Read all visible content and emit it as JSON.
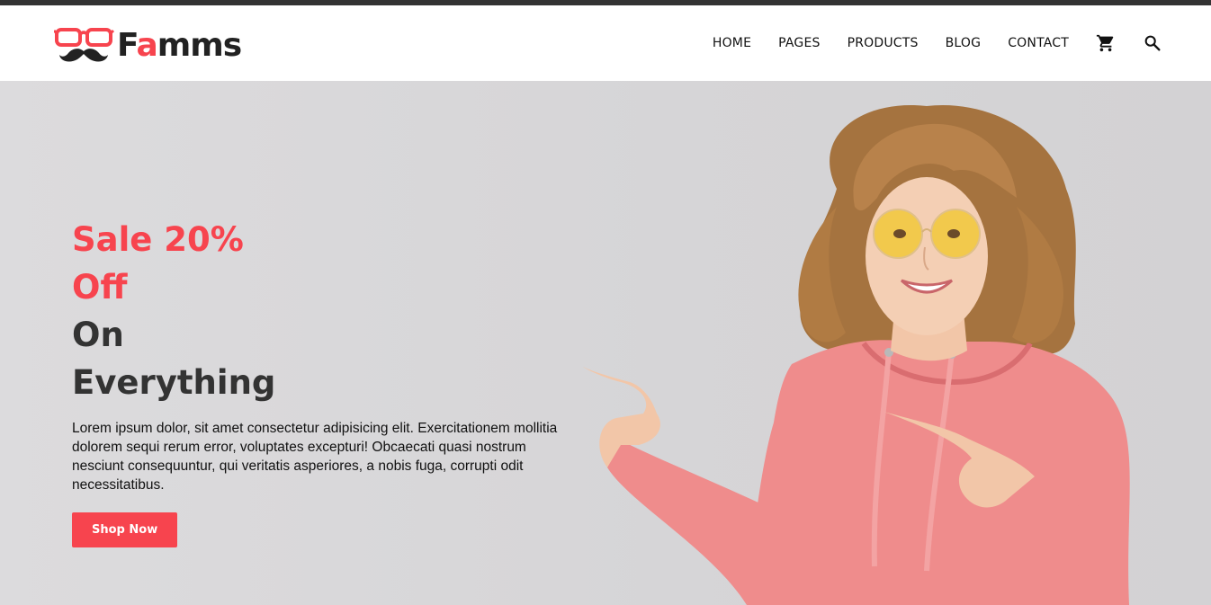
{
  "brand": {
    "name_prefix": "F",
    "name_accent": "a",
    "name_suffix": "mms",
    "accent_color": "#f7444e",
    "logo_icon": "glasses-mustache-icon"
  },
  "nav": {
    "items": [
      {
        "label": "HOME"
      },
      {
        "label": "PAGES"
      },
      {
        "label": "PRODUCTS"
      },
      {
        "label": "BLOG"
      },
      {
        "label": "CONTACT"
      }
    ],
    "cart_icon": "cart-icon",
    "search_icon": "search-icon"
  },
  "hero": {
    "title_line1": "Sale 20%",
    "title_line2": "Off",
    "title_line3": "On",
    "title_line4": "Everything",
    "description": "Lorem ipsum dolor, sit amet consectetur adipisicing elit. Exercitationem mollitia dolorem sequi rerum error, voluptates excepturi! Obcaecati quasi nostrum nesciunt consequuntur, qui veritatis asperiores, a nobis fuga, corrupti odit necessitatibus.",
    "cta_label": "Shop Now",
    "image_subject": "woman-in-pink-hoodie-pointing"
  }
}
